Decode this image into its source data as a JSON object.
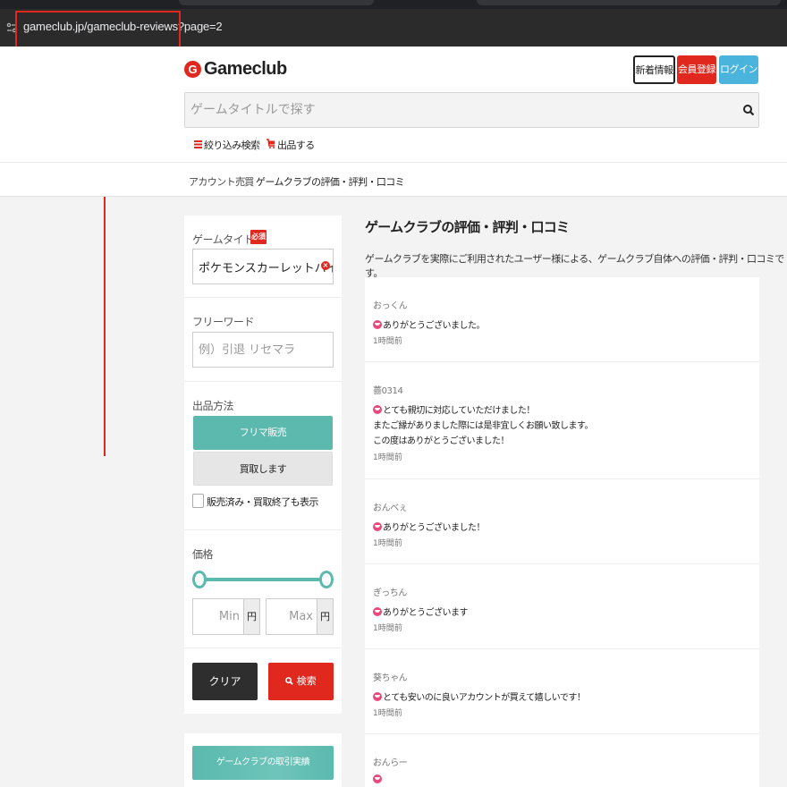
{
  "browser": {
    "url": "gameclub.jp/gameclub-reviews?page=2",
    "site_icon": "site-info-icon"
  },
  "header": {
    "logo_mark": "G",
    "logo_text": "Gameclub",
    "buttons": {
      "news": "新着情報",
      "register": "会員登録",
      "login": "ログイン"
    },
    "search_placeholder": "ゲームタイトルで探す",
    "links": {
      "filter": "絞り込み検索",
      "sell": "出品する"
    }
  },
  "breadcrumb": {
    "root": "アカウント売買",
    "separator": "〉",
    "current": "ゲームクラブの評価・評判・口コミ"
  },
  "sidebar": {
    "title_label": "ゲームタイトル",
    "required_badge": "必須",
    "title_value": "ポケモンスカーレットバイオ",
    "freeword_label": "フリーワード",
    "freeword_placeholder": "例）引退 リセマラ",
    "method_label": "出品方法",
    "method_flea": "フリマ販売",
    "method_buy": "買取します",
    "sold_checkbox_label": "販売済み・買取終了も表示",
    "price_label": "価格",
    "price_min_placeholder": "Min",
    "price_max_placeholder": "Max",
    "yen": "円",
    "clear_button": "クリア",
    "search_button": "検索",
    "results_button": "ゲームクラブの取引実績"
  },
  "main": {
    "title": "ゲームクラブの評価・評判・口コミ",
    "description": "ゲームクラブを実際にご利用されたユーザー様による、ゲームクラブ自体への評価・評判・口コミです。",
    "reviews": [
      {
        "name": "おっくん",
        "lines": [
          "ありがとうございました。"
        ],
        "time": "1時間前"
      },
      {
        "name": "薔0314",
        "lines": [
          "とても親切に対応していただけました！",
          "またご縁がありました際には是非宜しくお願い致します。",
          "この度はありがとうございました！"
        ],
        "time": "1時間前"
      },
      {
        "name": "おんべぇ",
        "lines": [
          "ありがとうございました！"
        ],
        "time": "1時間前"
      },
      {
        "name": "ぎっちん",
        "lines": [
          "ありがとうございます"
        ],
        "time": "1時間前"
      },
      {
        "name": "葵ちゃん",
        "lines": [
          "とても安いのに良いアカウントが買えて嬉しいです！"
        ],
        "time": "1時間前"
      },
      {
        "name": "おんらー",
        "lines": [
          ""
        ],
        "time": ""
      }
    ]
  },
  "colors": {
    "brand_red": "#e0281f",
    "teal": "#5bb9ad",
    "login_blue": "#4bb4dd",
    "smile_pink": "#e8497a"
  }
}
